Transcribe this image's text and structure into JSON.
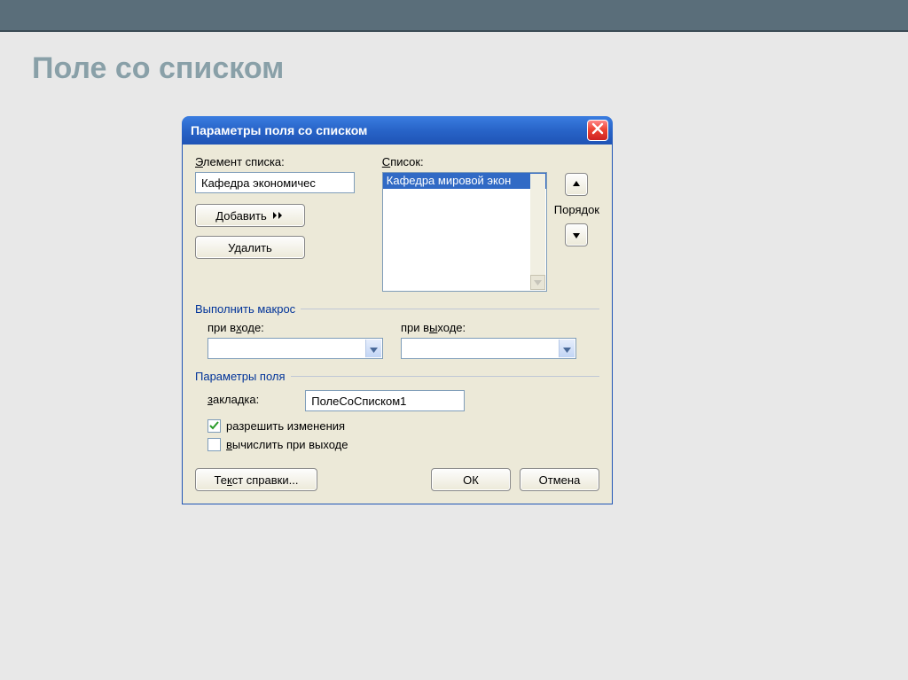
{
  "page": {
    "background_title": "Поле со списком"
  },
  "dialog": {
    "title": "Параметры поля со списком",
    "labels": {
      "element": "Элемент списка:",
      "list": "Список:",
      "order": "Порядок",
      "macro_section": "Выполнить макрос",
      "on_enter": "при входе:",
      "on_exit": "при выходе:",
      "params_section": "Параметры поля",
      "bookmark": "закладка:"
    },
    "element_value": "Кафедра экономичес",
    "list_items": [
      "Кафедра мировой экон"
    ],
    "selected_index": 0,
    "buttons": {
      "add": "Добавить",
      "delete": "Удалить",
      "help": "Текст справки...",
      "ok": "ОК",
      "cancel": "Отмена"
    },
    "macro": {
      "on_enter": "",
      "on_exit": ""
    },
    "bookmark_value": "ПолеСоСписком1",
    "checks": {
      "allow_changes": {
        "label": "разрешить изменения",
        "checked": true
      },
      "calc_on_exit": {
        "label": "вычислить при выходе",
        "checked": false
      }
    }
  }
}
